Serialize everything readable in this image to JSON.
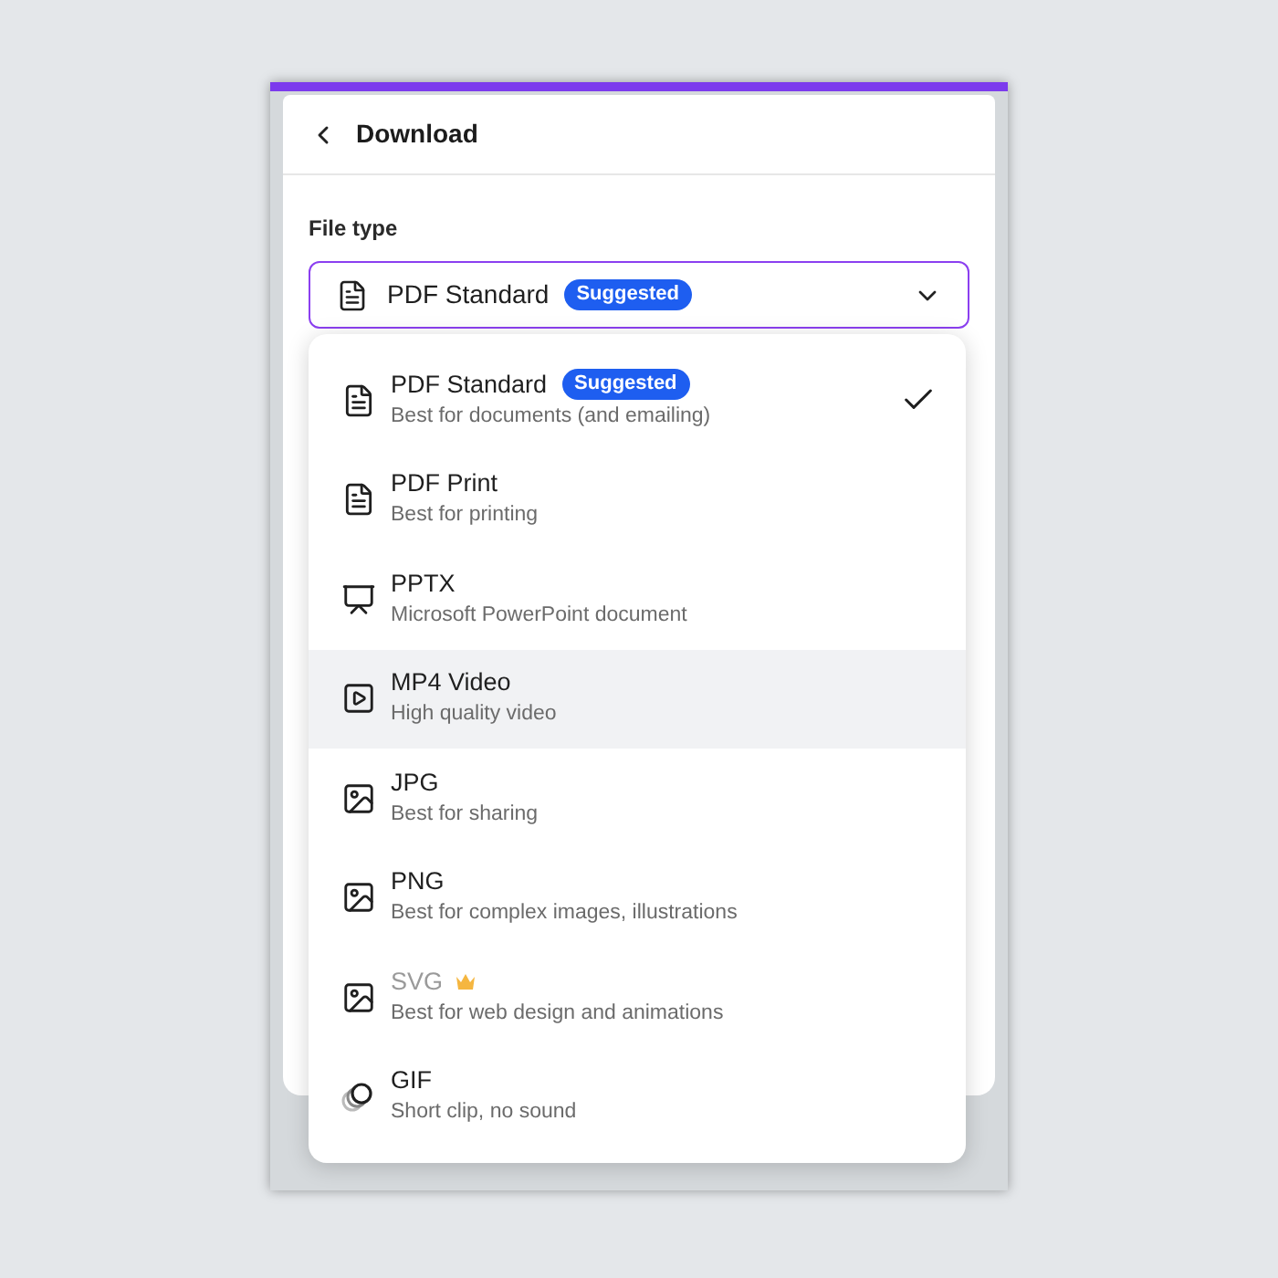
{
  "header": {
    "title": "Download"
  },
  "file_type": {
    "label": "File type",
    "value": "PDF Standard",
    "badge": "Suggested",
    "expanded": true
  },
  "options": [
    {
      "kind": "document",
      "title": "PDF Standard",
      "badge": "Suggested",
      "subtitle": "Best for documents (and emailing)",
      "selected": true,
      "highlighted": false,
      "premium": false
    },
    {
      "kind": "document",
      "title": "PDF Print",
      "subtitle": "Best for printing",
      "selected": false,
      "highlighted": false,
      "premium": false
    },
    {
      "kind": "presentation",
      "title": "PPTX",
      "subtitle": "Microsoft PowerPoint document",
      "selected": false,
      "highlighted": false,
      "premium": false
    },
    {
      "kind": "video",
      "title": "MP4 Video",
      "subtitle": "High quality video",
      "selected": false,
      "highlighted": true,
      "premium": false
    },
    {
      "kind": "image",
      "title": "JPG",
      "subtitle": "Best for sharing",
      "selected": false,
      "highlighted": false,
      "premium": false
    },
    {
      "kind": "image",
      "title": "PNG",
      "subtitle": "Best for complex images, illustrations",
      "selected": false,
      "highlighted": false,
      "premium": false
    },
    {
      "kind": "image",
      "title": "SVG",
      "subtitle": "Best for web design and animations",
      "selected": false,
      "highlighted": false,
      "premium": true
    },
    {
      "kind": "gif",
      "title": "GIF",
      "subtitle": "Short clip, no sound",
      "selected": false,
      "highlighted": false,
      "premium": false
    }
  ]
}
